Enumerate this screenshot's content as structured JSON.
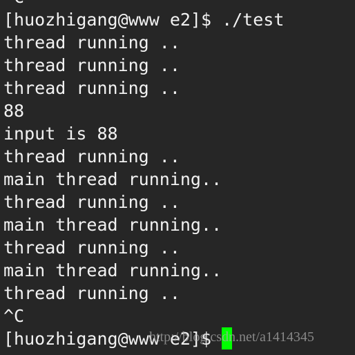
{
  "terminal": {
    "lines": [
      "^C",
      "[huozhigang@www e2]$ ./test",
      "thread running ..",
      "thread running ..",
      "thread running ..",
      "88",
      "input is 88",
      "thread running ..",
      "main thread running..",
      "thread running ..",
      "main thread running..",
      "thread running ..",
      "main thread running..",
      "thread running ..",
      "^C"
    ],
    "prompt": "[huozhigang@www e2]$",
    "cursor_color": "#00ff00",
    "background": "#262626",
    "foreground": "#f2f2f2"
  },
  "watermark": "http://blog.csdn.net/a1414345"
}
